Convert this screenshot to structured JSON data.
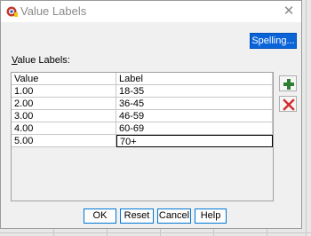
{
  "window": {
    "title": "Value Labels",
    "close_glyph": "✕",
    "icon": "spss-app-icon"
  },
  "spelling_button": "Spelling...",
  "value_labels_caption": {
    "accel": "V",
    "rest": "alue Labels:"
  },
  "grid": {
    "columns": [
      "Value",
      "Label"
    ],
    "rows": [
      {
        "value": "1.00",
        "label": "18-35"
      },
      {
        "value": "2.00",
        "label": "36-45"
      },
      {
        "value": "3.00",
        "label": "46-59"
      },
      {
        "value": "4.00",
        "label": "60-69"
      },
      {
        "value": "5.00",
        "label": "70+"
      }
    ]
  },
  "side_buttons": {
    "add_icon": "plus-icon",
    "remove_icon": "x-icon",
    "add_color": "#2e7d32",
    "remove_color": "#d32f2f"
  },
  "footer": {
    "ok": "OK",
    "reset": "Reset",
    "cancel": "Cancel",
    "help": "Help"
  },
  "colors": {
    "accent": "#0a64d8",
    "focus_border": "#0078d7"
  }
}
